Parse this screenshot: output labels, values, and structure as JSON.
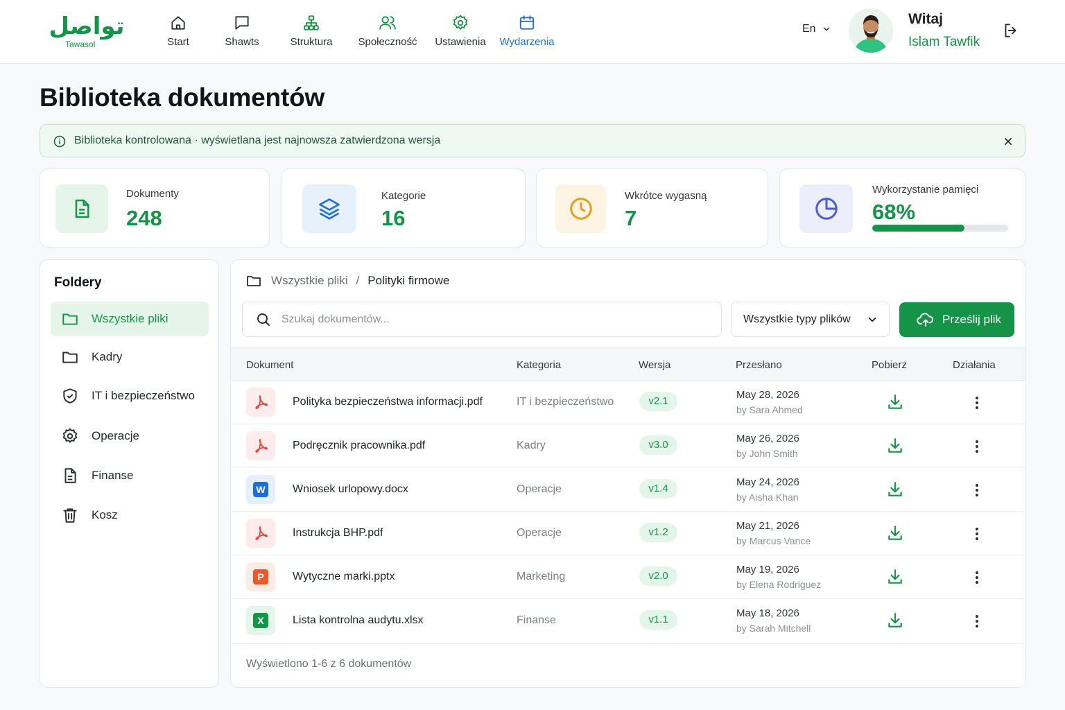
{
  "header": {
    "logo_arabic": "تواصل",
    "logo_latin": "Tawasol",
    "nav": [
      {
        "label": "Start",
        "icon": "home-icon"
      },
      {
        "label": "Shawts",
        "icon": "chat-icon"
      },
      {
        "label": "Struktura",
        "icon": "org-chart-icon"
      },
      {
        "label": "Społeczność",
        "icon": "users-icon"
      },
      {
        "label": "Ustawienia",
        "icon": "gear-icon"
      },
      {
        "label": "Wydarzenia",
        "icon": "calendar-icon",
        "active": true
      }
    ],
    "language": "En",
    "greeting": "Witaj",
    "user_name": "Islam Tawfik"
  },
  "page_title": "Biblioteka dokumentów",
  "banner": {
    "text": "Biblioteka kontrolowana · wyświetlana jest najnowsza zatwierdzona wersja"
  },
  "stats": [
    {
      "label": "Dokumenty",
      "value": "248",
      "icon": "document-icon",
      "bg": "#e6f5ea",
      "color": "#159447"
    },
    {
      "label": "Kategorie",
      "value": "16",
      "icon": "layers-icon",
      "bg": "#e7f1fc",
      "color": "#1c6fd8"
    },
    {
      "label": "Wkrótce wygasną",
      "value": "7",
      "icon": "clock-icon",
      "bg": "#fdf4e3",
      "color": "#e3a01a"
    },
    {
      "label": "Wykorzystanie pamięci",
      "value": "68%",
      "icon": "pie-chart-icon",
      "bg": "#eceefc",
      "color": "#4c5bd4",
      "progress": 0.68
    }
  ],
  "sidebar": {
    "title": "Foldery",
    "items": [
      {
        "label": "Wszystkie pliki",
        "icon": "folder-icon",
        "active": true
      },
      {
        "label": "Kadry",
        "icon": "folder-icon"
      },
      {
        "label": "IT i bezpieczeństwo",
        "icon": "shield-icon"
      },
      {
        "label": "Operacje",
        "icon": "gear-icon"
      },
      {
        "label": "Finanse",
        "icon": "document-icon"
      },
      {
        "label": "Kosz",
        "icon": "trash-icon"
      }
    ]
  },
  "breadcrumb": {
    "root": "Wszystkie pliki",
    "separator": "/",
    "current": "Polityki firmowe"
  },
  "search": {
    "placeholder": "Szukaj dokumentów..."
  },
  "filter": {
    "selected": "Wszystkie typy plików"
  },
  "upload_label": "Prześlij plik",
  "table": {
    "headers": [
      "Dokument",
      "Kategoria",
      "Wersja",
      "Przesłano",
      "Pobierz",
      "Działania"
    ],
    "rows": [
      {
        "name": "Polityka bezpieczeństwa informacji.pdf",
        "type": "pdf",
        "category": "IT i bezpieczeństwo",
        "version": "v2.1",
        "date": "May 28, 2026",
        "by": "by Sara Ahmed"
      },
      {
        "name": "Podręcznik pracownika.pdf",
        "type": "pdf",
        "category": "Kadry",
        "version": "v3.0",
        "date": "May 26, 2026",
        "by": "by John Smith"
      },
      {
        "name": "Wniosek urlopowy.docx",
        "type": "word",
        "category": "Operacje",
        "version": "v1.4",
        "date": "May 24, 2026",
        "by": "by Aisha Khan"
      },
      {
        "name": "Instrukcja BHP.pdf",
        "type": "pdf",
        "category": "Operacje",
        "version": "v1.2",
        "date": "May 21, 2026",
        "by": "by Marcus Vance"
      },
      {
        "name": "Wytyczne marki.pptx",
        "type": "ppt",
        "category": "Marketing",
        "version": "v2.0",
        "date": "May 19, 2026",
        "by": "by Elena Rodriguez"
      },
      {
        "name": "Lista kontrolna audytu.xlsx",
        "type": "excel",
        "category": "Finanse",
        "version": "v1.1",
        "date": "May 18, 2026",
        "by": "by Sarah Mitchell"
      }
    ],
    "footer": "Wyświetlono 1-6 z 6 dokumentów"
  },
  "colors": {
    "primary": "#159447",
    "active_nav": "#1c6fd8"
  }
}
